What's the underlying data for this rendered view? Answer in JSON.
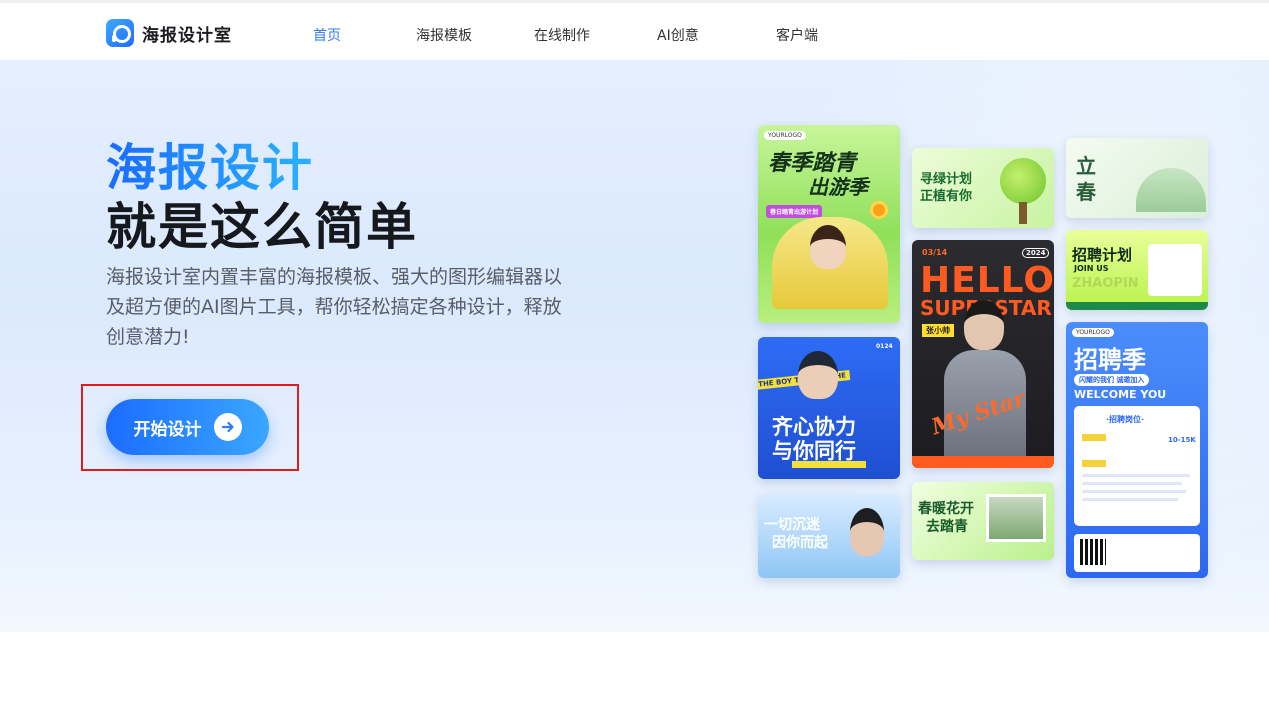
{
  "nav": {
    "logo_text": "海报设计室",
    "items": [
      {
        "label": "首页",
        "active": true
      },
      {
        "label": "海报模板"
      },
      {
        "label": "在线制作"
      },
      {
        "label": "AI创意"
      },
      {
        "label": "客户端"
      }
    ]
  },
  "hero": {
    "title_line1": "海报设计",
    "title_line2": "就是这么简单",
    "description": "海报设计室内置丰富的海报模板、强大的图形编辑器以及超方便的AI图片工具，帮你轻松搞定各种设计，释放创意潜力!",
    "start_button_label": "开始设计"
  },
  "posters": {
    "spring_outing": {
      "logo": "YOURLOGO",
      "title_a": "春季踏青",
      "title_b": "出游季",
      "tag": "春日踏青出游计划"
    },
    "green_plan": {
      "title_a": "寻绿计划",
      "title_b": "正植有你"
    },
    "lichun": {
      "title_a": "立",
      "title_b": "春"
    },
    "teamwork": {
      "badge": "0124",
      "title_a": "齐心协力",
      "title_b": "与你同行",
      "ribbon": "THE BOY THE BOY THE"
    },
    "hello_superstar": {
      "date": "03/14",
      "year": "2024",
      "title_a": "HELLO",
      "title_b": "SUPERSTAR",
      "name_tag": "张小帅",
      "signature": "My Star"
    },
    "recruit_plan": {
      "title": "招聘计划",
      "sub": "JOIN US",
      "bg_word": "ZHAOPIN"
    },
    "recruit_season": {
      "logo": "YOURLOGO",
      "title": "招聘季",
      "sub": "闪耀的我们 诚邀加入",
      "welcome": "WELCOME YOU",
      "section": "·招聘岗位·",
      "salary": "10-15K"
    },
    "lost_in_you": {
      "title_a": "一切沉迷",
      "title_b": "因你而起"
    },
    "spring_flowers": {
      "title_a": "春暖花开",
      "title_b": "去踏青"
    }
  },
  "colors": {
    "accent": "#2f7bff",
    "highlight_box": "#e01c1c"
  }
}
